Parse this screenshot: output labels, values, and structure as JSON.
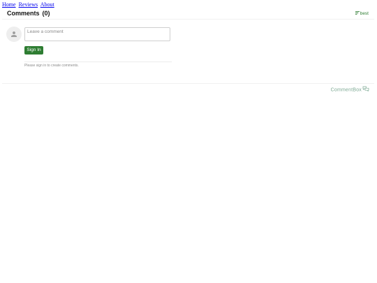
{
  "nav": {
    "links": [
      "Home",
      "Reviews",
      "About"
    ]
  },
  "comments": {
    "title": "Comments",
    "count": "(0)",
    "sort_label": "best",
    "sort_icon": "sort-icon",
    "avatar_icon": "user-icon",
    "input_placeholder": "Leave a comment",
    "input_value": "",
    "signin_label": "Sign In",
    "signin_note": "Please sign in to create comments.",
    "brand": "CommentBox",
    "brand_icon": "comment-bubbles-icon"
  },
  "colors": {
    "accent": "#2e7d32",
    "brand": "#7da993",
    "link": "#0000ee",
    "avatar_bg": "#eeeeee",
    "muted_text": "#8a8a8a"
  }
}
